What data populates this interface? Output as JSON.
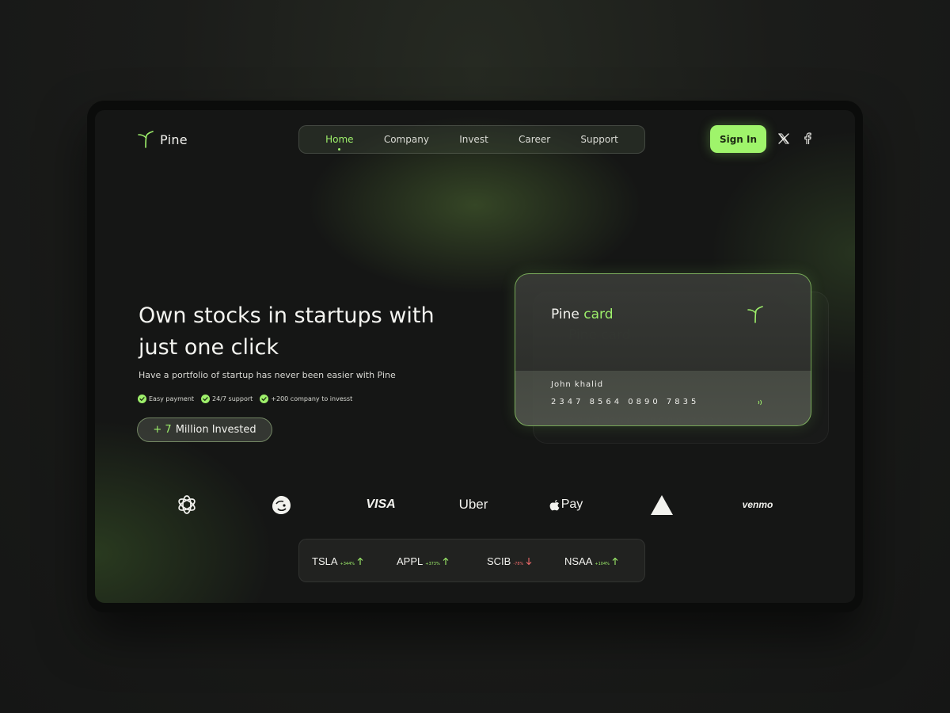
{
  "header": {
    "brand": "Pine",
    "nav": [
      {
        "label": "Home",
        "active": true
      },
      {
        "label": "Company",
        "active": false
      },
      {
        "label": "Invest",
        "active": false
      },
      {
        "label": "Career",
        "active": false
      },
      {
        "label": "Support",
        "active": false
      }
    ],
    "signin_label": "Sign In",
    "social": [
      "x-icon",
      "facebook-icon"
    ]
  },
  "hero": {
    "title": "Own stocks in startups with just one click",
    "subtitle": "Have a portfolio of startup has never been easier with Pine",
    "features": [
      "Easy payment",
      "24/7  support",
      "+200 company to invesst"
    ],
    "invested_prefix": "+ 7",
    "invested_text": "Million Invested"
  },
  "card": {
    "title_main": "Pine",
    "title_accent": "card",
    "holder": "John khalid",
    "number": "2347 8564 0890 7835"
  },
  "brands": [
    "openai-logo",
    "mailchimp-logo",
    "VISA",
    "Uber",
    "Pay",
    "vercel-logo",
    "venmo"
  ],
  "stocks": [
    {
      "symbol": "TSLA",
      "change": "+344%",
      "direction": "up"
    },
    {
      "symbol": "APPL",
      "change": "+373%",
      "direction": "up"
    },
    {
      "symbol": "SCIB",
      "change": "-78%",
      "direction": "down"
    },
    {
      "symbol": "NSAA",
      "change": "+104%",
      "direction": "up"
    }
  ],
  "colors": {
    "accent": "#9ef06b",
    "negative": "#f06b6b",
    "background": "#151615"
  }
}
